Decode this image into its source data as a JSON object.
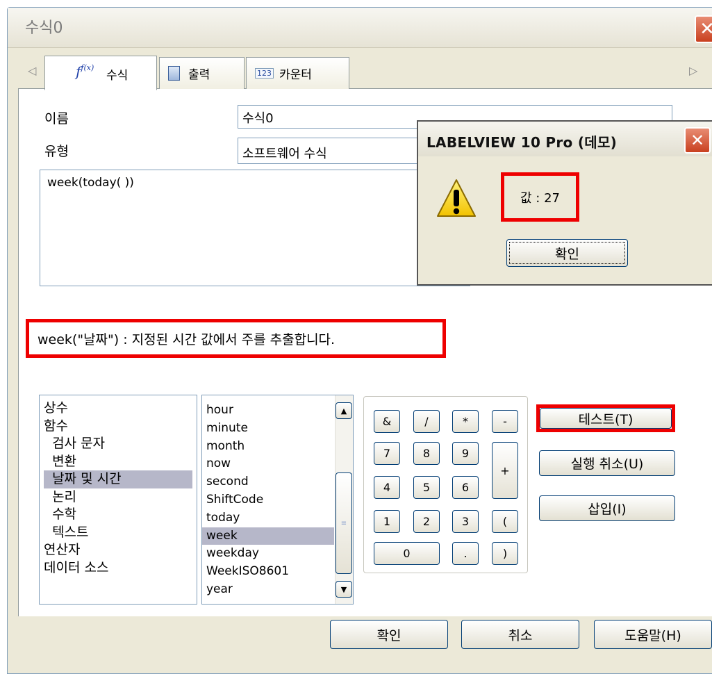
{
  "window": {
    "title": "수식0",
    "close_glyph": "✕"
  },
  "tabs": [
    {
      "label": "수식",
      "icon": "fx-icon",
      "icon_text": "f(x)"
    },
    {
      "label": "출력",
      "icon": "output-icon"
    },
    {
      "label": "카운터",
      "icon": "counter-icon",
      "icon_text": "123"
    }
  ],
  "tab_nav": {
    "left": "◁",
    "right": "▷"
  },
  "form": {
    "name_label": "이름",
    "name_value": "수식0",
    "type_label": "유형",
    "type_value": "소프트웨어 수식",
    "formula": "week(today( ))"
  },
  "description": "week(\"날짜\")  :  지정된 시간 값에서 주를 추출합니다.",
  "categories": {
    "items": [
      "상수",
      "함수",
      "  검사 문자",
      "  변환",
      "  날짜 및 시간",
      "  논리",
      "  수학",
      "  텍스트",
      "연산자",
      "데이터 소스"
    ],
    "selected": "  날짜 및 시간"
  },
  "functions": {
    "items": [
      "hour",
      "minute",
      "month",
      "now",
      "second",
      "ShiftCode",
      "today",
      "week",
      "weekday",
      "WeekISO8601",
      "year"
    ],
    "selected": "week"
  },
  "keypad": {
    "keys": [
      "&",
      "/",
      "*",
      "-",
      "7",
      "8",
      "9",
      "+",
      "4",
      "5",
      "6",
      "1",
      "2",
      "3",
      "(",
      "0",
      ".",
      ")"
    ]
  },
  "side_buttons": {
    "test": "테스트(T)",
    "undo": "실행 취소(U)",
    "insert": "삽입(I)"
  },
  "footer_buttons": {
    "ok": "확인",
    "cancel": "취소",
    "help": "도움말(H)"
  },
  "message_box": {
    "title": "LABELVIEW 10 Pro (데모)",
    "value_text": "값 : 27",
    "ok_label": "확인",
    "icon": "warning-icon"
  },
  "colors": {
    "highlight_box": "#ee0000",
    "selection": "#b6b7c9",
    "dialog_bg": "#ece9d8"
  }
}
